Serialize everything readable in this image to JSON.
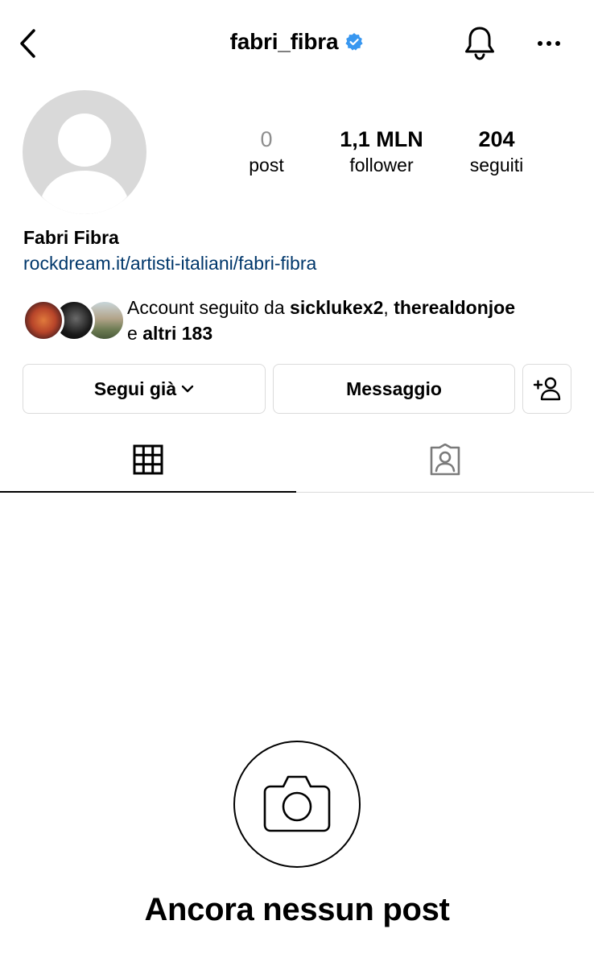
{
  "header": {
    "username": "fabri_fibra",
    "verified_icon": "verified-badge-icon",
    "back_icon": "chevron-left-icon",
    "bell_icon": "bell-icon",
    "more_icon": "more-horizontal-icon",
    "verified_color": "#3897f0"
  },
  "profile": {
    "stats": {
      "posts": {
        "value": "0",
        "label": "post"
      },
      "followers": {
        "value": "1,1 MLN",
        "label": "follower"
      },
      "following": {
        "value": "204",
        "label": "seguiti"
      }
    },
    "full_name": "Fabri Fibra",
    "link": "rockdream.it/artisti-italiani/fabri-fibra",
    "link_color": "#00376b",
    "mutual": {
      "prefix": "Account seguito da ",
      "user1": "sicklukex2",
      "separator": ", ",
      "user2": "therealdonjoe",
      "connector": "e ",
      "others": "altri 183"
    }
  },
  "actions": {
    "follow_label": "Segui già",
    "message_label": "Messaggio",
    "add_user_icon": "add-user-icon"
  },
  "tabs": {
    "grid_icon": "grid-icon",
    "tagged_icon": "tagged-user-icon"
  },
  "empty_state": {
    "icon": "camera-icon",
    "title": "Ancora nessun post"
  }
}
